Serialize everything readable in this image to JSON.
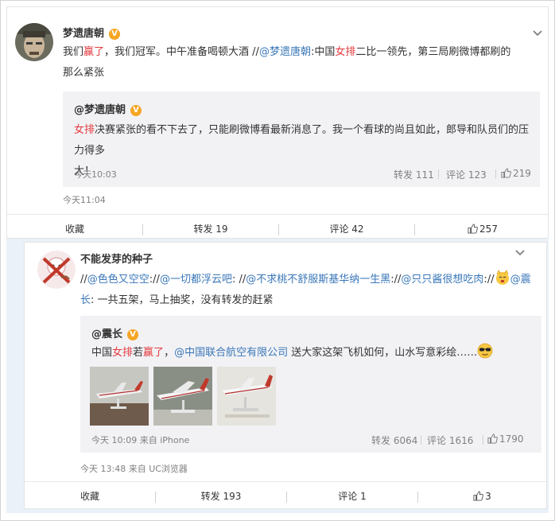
{
  "post1": {
    "author": "梦遗唐朝",
    "text_a": "我们",
    "text_b": "赢了",
    "text_c": "，我们冠军。中午准备喝顿大酒 //",
    "mention": "@梦遗唐朝",
    "text_d": ":中国",
    "text_e": "女排",
    "text_f": "二比一领先，第三局刷微博都刷的",
    "text_g": "那么紧张",
    "quote": {
      "author": "@梦遗唐朝",
      "text_a": "女排",
      "text_b": "决赛紧张的看不下去了，只能刷微博看最新消息了。我一个看球的尚且如此，郎导和队员们的压力得多",
      "text_c": "大！",
      "time": "今天10:03",
      "repost": "转发 111",
      "comment": "评论  123",
      "like": "219"
    },
    "time": "今天11:04",
    "actions": {
      "fav": "收藏",
      "repost": "转发 19",
      "comment": "评论 42",
      "like": "257"
    }
  },
  "post2": {
    "author": "不能发芽的种子",
    "line1": [
      {
        "t": "//",
        "c": "plain"
      },
      {
        "t": "@色色又空空",
        "c": "link"
      },
      {
        "t": ":",
        "c": "plain"
      },
      {
        "t": "//",
        "c": "plain"
      },
      {
        "t": "@一切都浮云吧",
        "c": "link"
      },
      {
        "t": ": //",
        "c": "plain"
      },
      {
        "t": "@不求桃不舒服斯基华纳一生黑",
        "c": "link"
      },
      {
        "t": ":",
        "c": "plain"
      },
      {
        "t": "//",
        "c": "plain"
      },
      {
        "t": "@只只酱很想吃肉",
        "c": "link"
      },
      {
        "t": ":",
        "c": "plain"
      }
    ],
    "line1_tail": "//",
    "mention_end_a": "@震",
    "mention_end_b": "长",
    "line2": ": 一共五架，马上抽奖，没有转发的赶紧",
    "quote": {
      "author": "@震长",
      "text_a": "中国",
      "text_b": "女排",
      "text_c": "若",
      "text_d": "赢了",
      "text_e": "，",
      "mention": "@中国联合航空有限公司",
      "text_f": " 送大家这架飞机如何，山水写意彩绘……",
      "time": "今天 10:09 来自 iPhone",
      "repost": "转发 6064",
      "comment": "评论  1616",
      "like": "1790"
    },
    "time": "今天 13:48 来自 UC浏览器",
    "actions": {
      "fav": "收藏",
      "repost": "转发 193",
      "comment": "评论 1",
      "like": "3"
    }
  },
  "colors": {
    "link": "#3a77b8",
    "highlight": "#e4393c",
    "verified": "#f5a623",
    "meta": "#808080",
    "quote_bg": "#f2f2f5"
  },
  "icons": [
    "verified-badge-icon",
    "chevron-down-icon",
    "thumbs-up-icon",
    "cat-emoji-icon",
    "sunglasses-emoji-icon"
  ]
}
